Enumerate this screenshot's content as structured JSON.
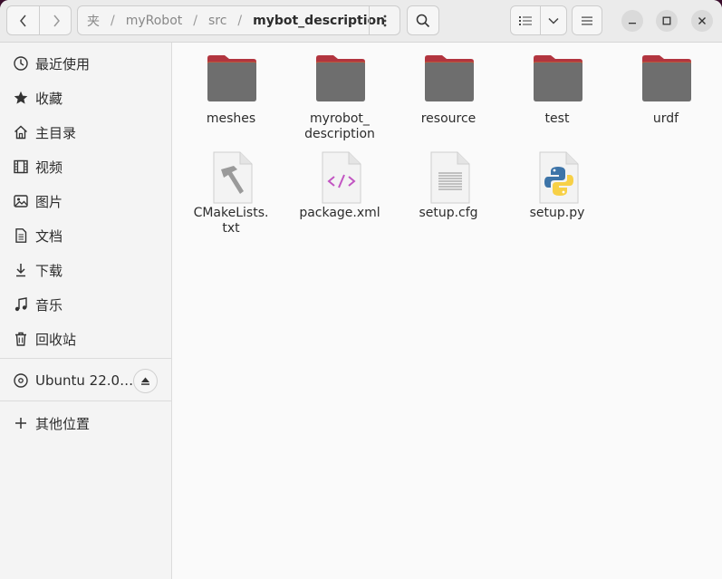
{
  "breadcrumbs": [
    {
      "label": "夹",
      "current": false
    },
    {
      "label": "myRobot",
      "current": false
    },
    {
      "label": "src",
      "current": false
    },
    {
      "label": "mybot_description",
      "current": true
    }
  ],
  "breadcrumb_separator": "/",
  "sidebar": {
    "places": [
      {
        "label": "最近使用",
        "icon": "clock-icon"
      },
      {
        "label": "收藏",
        "icon": "star-icon"
      },
      {
        "label": "主目录",
        "icon": "home-icon"
      },
      {
        "label": "视频",
        "icon": "film-icon"
      },
      {
        "label": "图片",
        "icon": "image-icon"
      },
      {
        "label": "文档",
        "icon": "document-icon"
      },
      {
        "label": "下载",
        "icon": "download-icon"
      },
      {
        "label": "音乐",
        "icon": "music-icon"
      },
      {
        "label": "回收站",
        "icon": "trash-icon"
      }
    ],
    "devices": [
      {
        "label": "Ubuntu 22.0…",
        "icon": "disc-icon"
      }
    ],
    "other": {
      "label": "其他位置",
      "icon": "plus-icon"
    }
  },
  "files": [
    {
      "name": "meshes",
      "type": "folder"
    },
    {
      "name": "myrobot_\ndescription",
      "type": "folder"
    },
    {
      "name": "resource",
      "type": "folder"
    },
    {
      "name": "test",
      "type": "folder"
    },
    {
      "name": "urdf",
      "type": "folder"
    },
    {
      "name": "CMakeLists.\ntxt",
      "type": "cmake"
    },
    {
      "name": "package.xml",
      "type": "xml"
    },
    {
      "name": "setup.cfg",
      "type": "text"
    },
    {
      "name": "setup.py",
      "type": "python"
    }
  ],
  "colors": {
    "folder_body": "#6e6e6e",
    "folder_tab": "#b2353f",
    "accent": "#e95420"
  }
}
